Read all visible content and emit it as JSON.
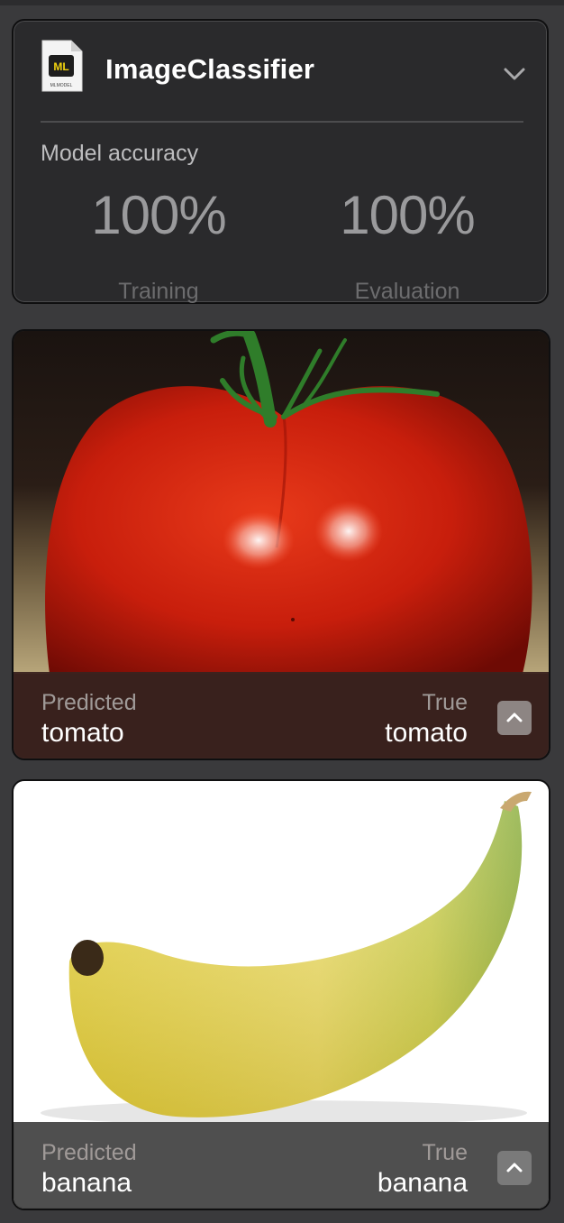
{
  "model": {
    "icon": "mlmodel-file-icon",
    "icon_badge": "ML",
    "icon_caption": "MLMODEL",
    "name": "ImageClassifier",
    "accuracy_label": "Model accuracy",
    "metrics": [
      {
        "value": "100%",
        "label": "Training"
      },
      {
        "value": "100%",
        "label": "Evaluation"
      }
    ]
  },
  "results": [
    {
      "image": "tomato-photo",
      "predicted_label": "Predicted",
      "predicted": "tomato",
      "true_label": "True",
      "true": "tomato"
    },
    {
      "image": "banana-photo",
      "predicted_label": "Predicted",
      "predicted": "banana",
      "true_label": "True",
      "true": "banana"
    }
  ],
  "colors": {
    "panel_background": "#3a3a3c",
    "card_background": "#2a2a2c",
    "text_primary": "#ffffff",
    "text_muted": "#9a9a9c",
    "icon_accent": "#f2d30f"
  }
}
